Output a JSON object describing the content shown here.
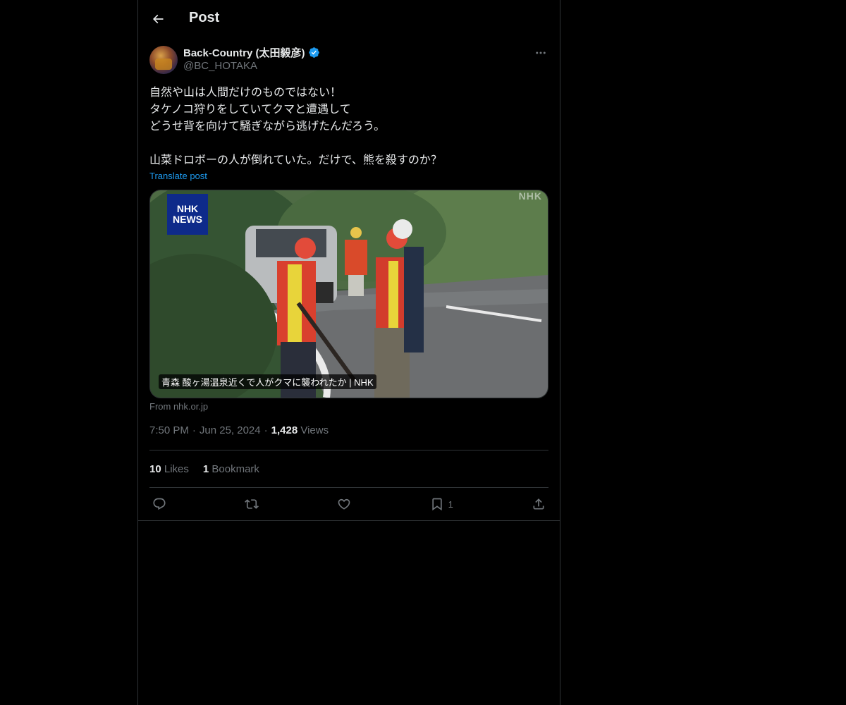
{
  "header": {
    "title": "Post",
    "back_icon": "arrow-left-icon"
  },
  "author": {
    "display_name": "Back-Country (太田毅彦)",
    "handle": "@BC_HOTAKA",
    "verified_icon": "verified-badge-icon",
    "verified_color": "#1d9bf0",
    "more_icon": "more-horizontal-icon"
  },
  "post": {
    "text": "自然や山は人間だけのものではない！\nタケノコ狩りをしていてクマと遭遇して\nどうせ背を向けて騒ぎながら逃げたんだろう。\n\n山菜ドロボーの人が倒れていた。だけで、熊を殺すのか？",
    "translate_label": "Translate post"
  },
  "media": {
    "logo_line1": "NHK",
    "logo_line2": "NEWS",
    "corner_mark": "NHK",
    "caption": "青森 酸ヶ湯温泉近くで人がクマに襲われたか | NHK",
    "source": "From nhk.or.jp"
  },
  "meta": {
    "time": "7:50 PM",
    "date": "Jun 25, 2024",
    "views_count": "1,428",
    "views_label": "Views",
    "separator": "·"
  },
  "stats": {
    "likes_count": "10",
    "likes_label": "Likes",
    "bookmarks_count": "1",
    "bookmarks_label": "Bookmark"
  },
  "actions": {
    "reply_icon": "reply-icon",
    "repost_icon": "repost-icon",
    "like_icon": "heart-icon",
    "bookmark_icon": "bookmark-icon",
    "bookmark_count": "1",
    "share_icon": "share-icon"
  },
  "colors": {
    "background": "#000000",
    "text": "#e7e9ea",
    "secondary": "#71767b",
    "accent": "#1d9bf0",
    "border": "#2f3336"
  }
}
